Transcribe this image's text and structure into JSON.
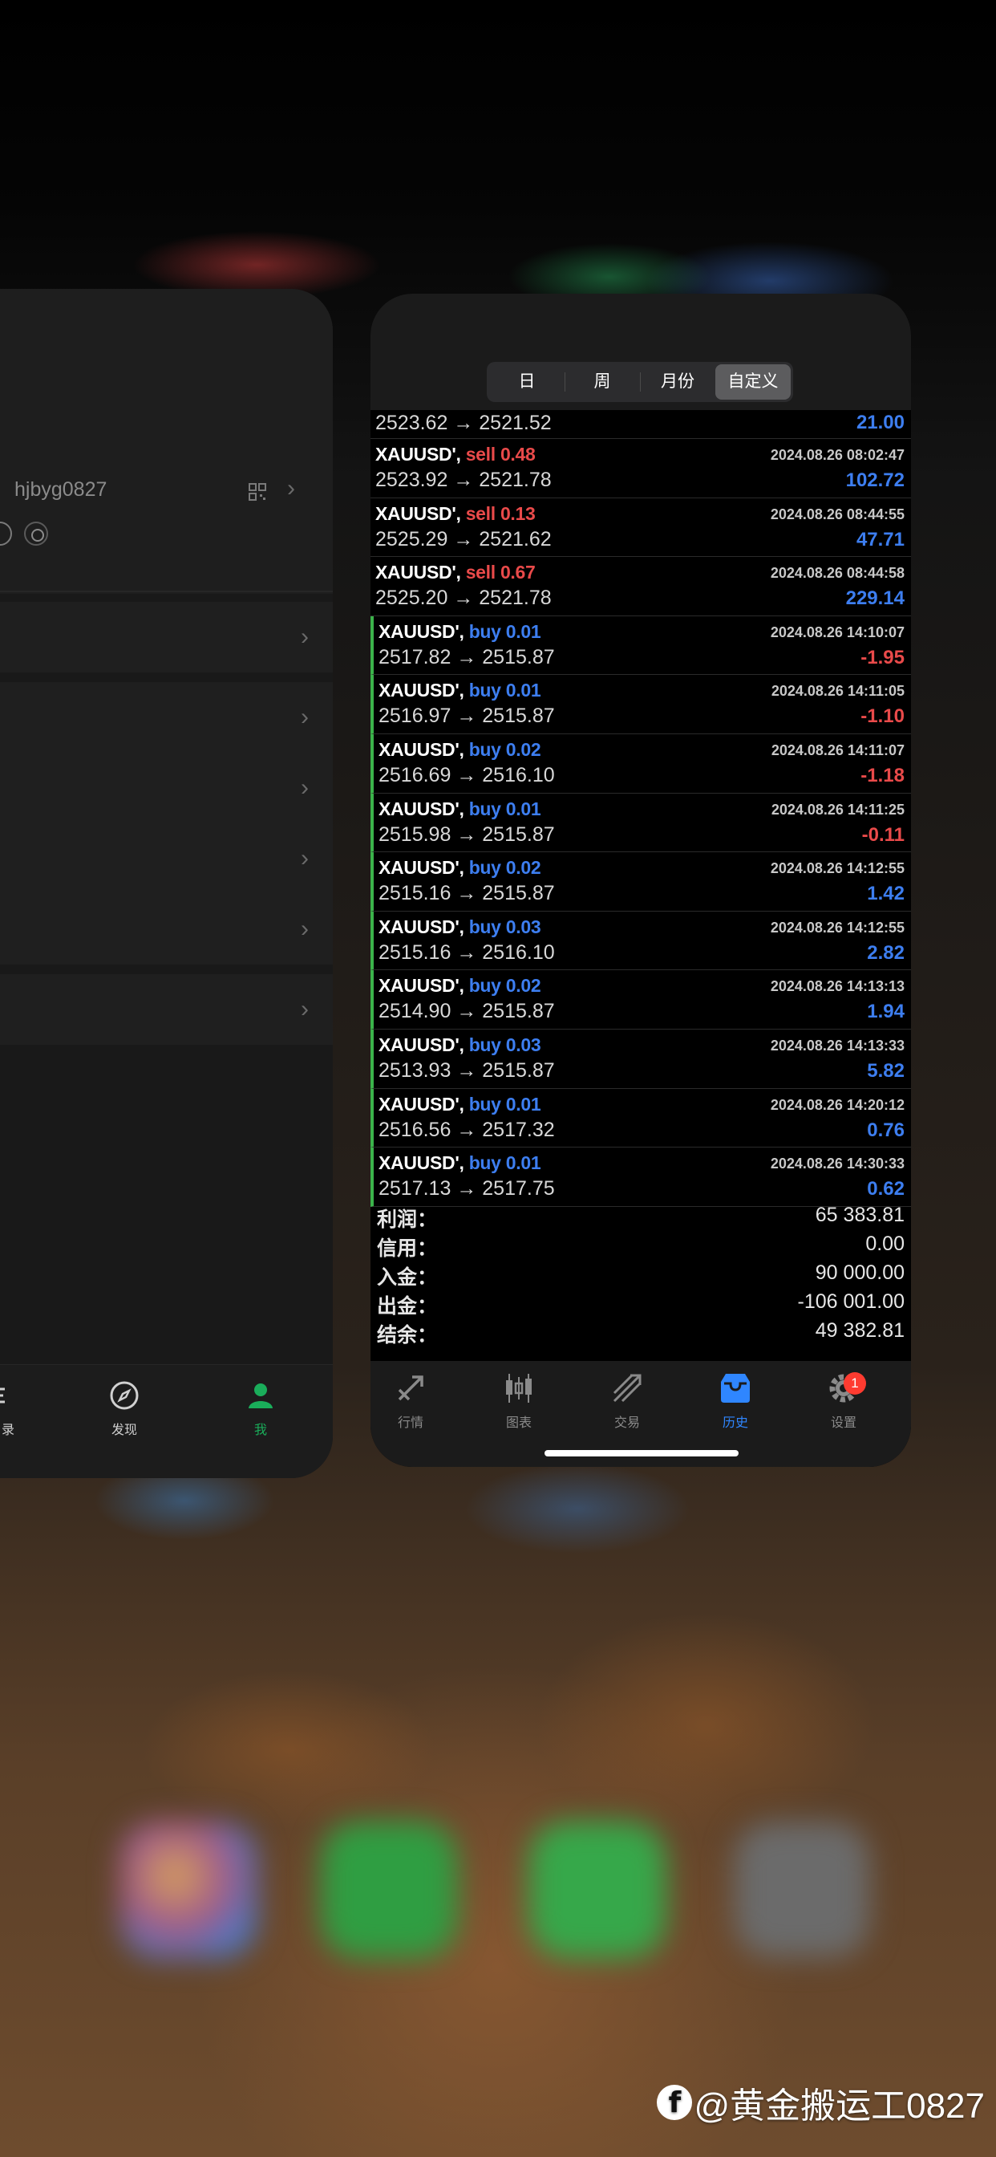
{
  "left_card": {
    "username": "hjbyg0827",
    "tabs": [
      {
        "label": "录",
        "icon": "list-icon"
      },
      {
        "label": "发现",
        "icon": "compass-icon"
      },
      {
        "label": "我",
        "icon": "person-icon",
        "active": true
      }
    ]
  },
  "right_card": {
    "period_tabs": [
      "日",
      "周",
      "月份",
      "自定义"
    ],
    "active_period": "自定义",
    "first_partial": {
      "prices": "2523.62 → 2521.52",
      "profit": "21.00"
    },
    "trades": [
      {
        "symbol": "XAUUSD',",
        "side": "sell 0.48",
        "type": "sell",
        "date": "2024.08.26 08:02:47",
        "prices": "2523.92 → 2521.78",
        "profit": "102.72",
        "profit_sign": "pos"
      },
      {
        "symbol": "XAUUSD',",
        "side": "sell 0.13",
        "type": "sell",
        "date": "2024.08.26 08:44:55",
        "prices": "2525.29 → 2521.62",
        "profit": "47.71",
        "profit_sign": "pos"
      },
      {
        "symbol": "XAUUSD',",
        "side": "sell 0.67",
        "type": "sell",
        "date": "2024.08.26 08:44:58",
        "prices": "2525.20 → 2521.78",
        "profit": "229.14",
        "profit_sign": "pos"
      },
      {
        "symbol": "XAUUSD',",
        "side": "buy 0.01",
        "type": "buy",
        "date": "2024.08.26 14:10:07",
        "prices": "2517.82 → 2515.87",
        "profit": "-1.95",
        "profit_sign": "neg"
      },
      {
        "symbol": "XAUUSD',",
        "side": "buy 0.01",
        "type": "buy",
        "date": "2024.08.26 14:11:05",
        "prices": "2516.97 → 2515.87",
        "profit": "-1.10",
        "profit_sign": "neg"
      },
      {
        "symbol": "XAUUSD',",
        "side": "buy 0.02",
        "type": "buy",
        "date": "2024.08.26 14:11:07",
        "prices": "2516.69 → 2516.10",
        "profit": "-1.18",
        "profit_sign": "neg"
      },
      {
        "symbol": "XAUUSD',",
        "side": "buy 0.01",
        "type": "buy",
        "date": "2024.08.26 14:11:25",
        "prices": "2515.98 → 2515.87",
        "profit": "-0.11",
        "profit_sign": "neg"
      },
      {
        "symbol": "XAUUSD',",
        "side": "buy 0.02",
        "type": "buy",
        "date": "2024.08.26 14:12:55",
        "prices": "2515.16 → 2515.87",
        "profit": "1.42",
        "profit_sign": "pos"
      },
      {
        "symbol": "XAUUSD',",
        "side": "buy 0.03",
        "type": "buy",
        "date": "2024.08.26 14:12:55",
        "prices": "2515.16 → 2516.10",
        "profit": "2.82",
        "profit_sign": "pos"
      },
      {
        "symbol": "XAUUSD',",
        "side": "buy 0.02",
        "type": "buy",
        "date": "2024.08.26 14:13:13",
        "prices": "2514.90 → 2515.87",
        "profit": "1.94",
        "profit_sign": "pos"
      },
      {
        "symbol": "XAUUSD',",
        "side": "buy 0.03",
        "type": "buy",
        "date": "2024.08.26 14:13:33",
        "prices": "2513.93 → 2515.87",
        "profit": "5.82",
        "profit_sign": "pos"
      },
      {
        "symbol": "XAUUSD',",
        "side": "buy 0.01",
        "type": "buy",
        "date": "2024.08.26 14:20:12",
        "prices": "2516.56 → 2517.32",
        "profit": "0.76",
        "profit_sign": "pos"
      },
      {
        "symbol": "XAUUSD',",
        "side": "buy 0.01",
        "type": "buy",
        "date": "2024.08.26 14:30:33",
        "prices": "2517.13 → 2517.75",
        "profit": "0.62",
        "profit_sign": "pos"
      }
    ],
    "summary": [
      {
        "label": "利润：",
        "value": "65 383.81"
      },
      {
        "label": "信用：",
        "value": "0.00"
      },
      {
        "label": "入金：",
        "value": "90 000.00"
      },
      {
        "label": "出金：",
        "value": "-106 001.00"
      },
      {
        "label": "结余：",
        "value": "49 382.81"
      }
    ],
    "tabs": [
      {
        "label": "行情",
        "icon": "quotes-icon"
      },
      {
        "label": "图表",
        "icon": "candlestick-icon"
      },
      {
        "label": "交易",
        "icon": "trade-icon"
      },
      {
        "label": "历史",
        "icon": "history-inbox-icon",
        "active": true
      },
      {
        "label": "设置",
        "icon": "gear-icon",
        "badge": "1"
      }
    ]
  },
  "watermark": "@黄金搬运工0827",
  "colors": {
    "sell": "#e94a4a",
    "buy": "#3d7ef0",
    "active_tab": "#2f86ff",
    "wechat_green": "#1aad5a",
    "buy_marker": "#3bb34a"
  }
}
